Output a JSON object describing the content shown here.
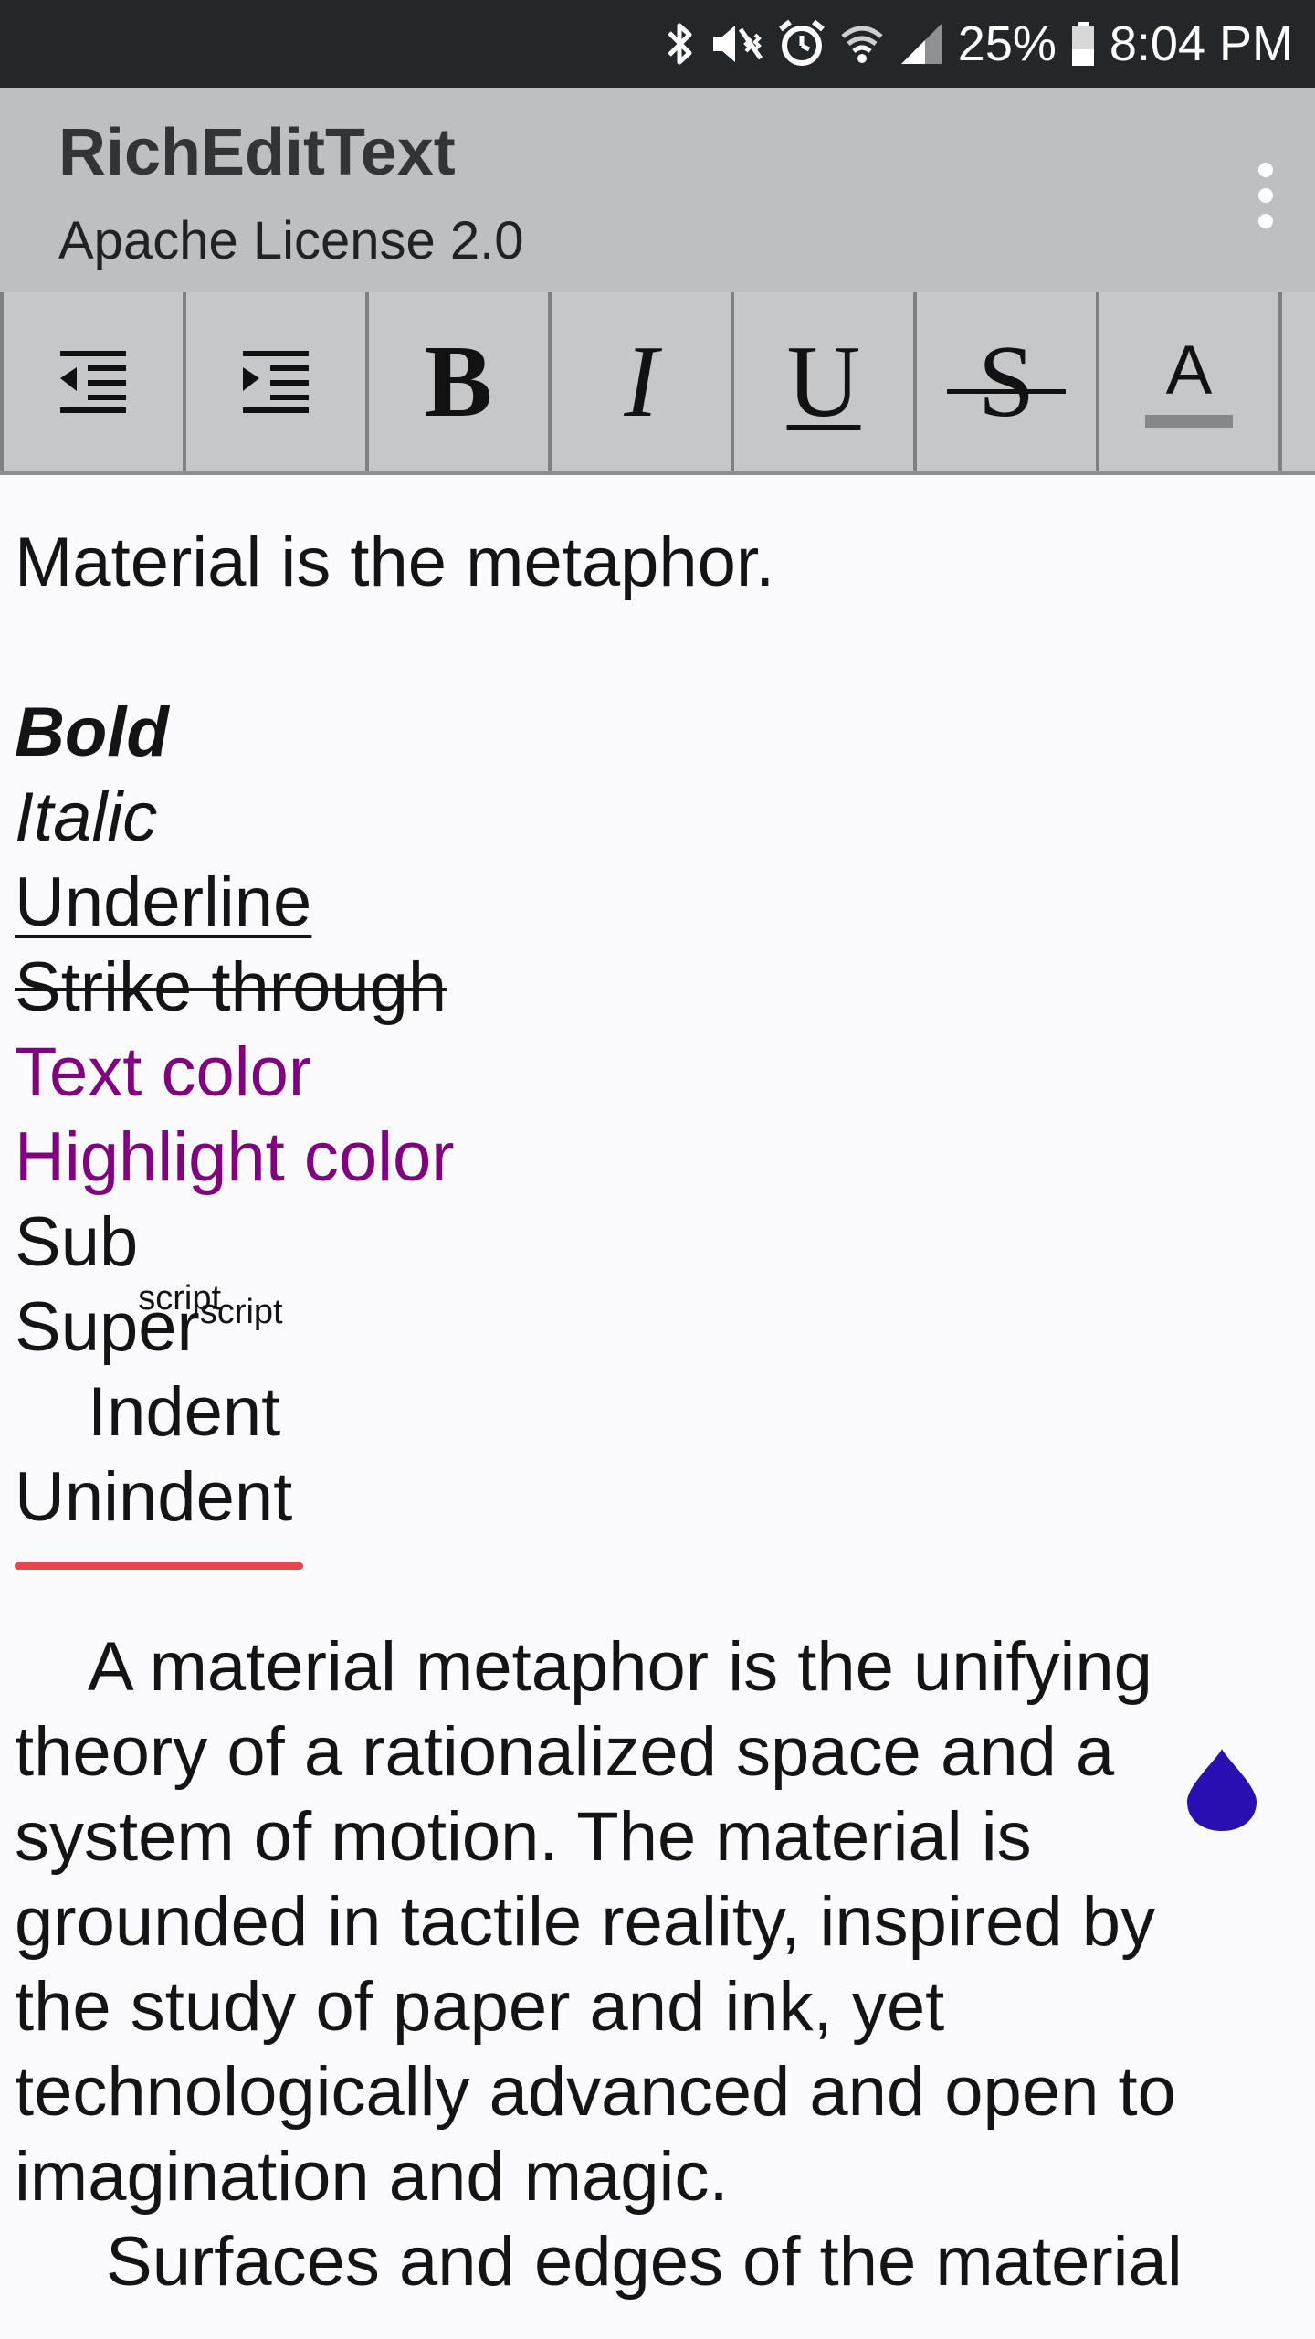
{
  "status_bar": {
    "battery": "25%",
    "time": "8:04 PM",
    "icons": [
      "bluetooth-icon",
      "mute-vibrate-icon",
      "alarm-icon",
      "wifi-icon",
      "signal-icon",
      "battery-icon"
    ]
  },
  "app_bar": {
    "title": "RichEditText",
    "subtitle": "Apache License 2.0",
    "overflow_icon": "more-vert-icon"
  },
  "toolbar": {
    "buttons": [
      {
        "name": "unindent",
        "icon": "format-indent-decrease-icon"
      },
      {
        "name": "indent",
        "icon": "format-indent-increase-icon"
      },
      {
        "name": "bold",
        "label": "B"
      },
      {
        "name": "italic",
        "label": "I"
      },
      {
        "name": "underline",
        "label": "U"
      },
      {
        "name": "strikethrough",
        "label": "S"
      },
      {
        "name": "text-color",
        "label": "A"
      }
    ]
  },
  "editor": {
    "heading": "Material is the metaphor.",
    "samples": {
      "bold": "Bold",
      "italic": "Italic",
      "underline": "Underline ",
      "strike": "Strike through ",
      "text_color": "Text color",
      "highlight_color": "Highlight color",
      "sub_base": "Sub",
      "sub_script": "script",
      "super_base": "Super",
      "super_script": "script",
      "indent": "Indent",
      "unindent": "Unindent"
    },
    "paragraph_lines": [
      "A material metaphor is the unifying",
      "theory of a rationalized space and a",
      "system of motion. The material is",
      "grounded in tactile reality, inspired by",
      "the study of paper and ink, yet",
      "technologically advanced and open to",
      "imagination and magic.",
      "Surfaces and edges of the material"
    ],
    "colors": {
      "text_color": "#800080",
      "spellcheck": "#e5474b",
      "cursor_handle": "#2a0fb0"
    }
  }
}
